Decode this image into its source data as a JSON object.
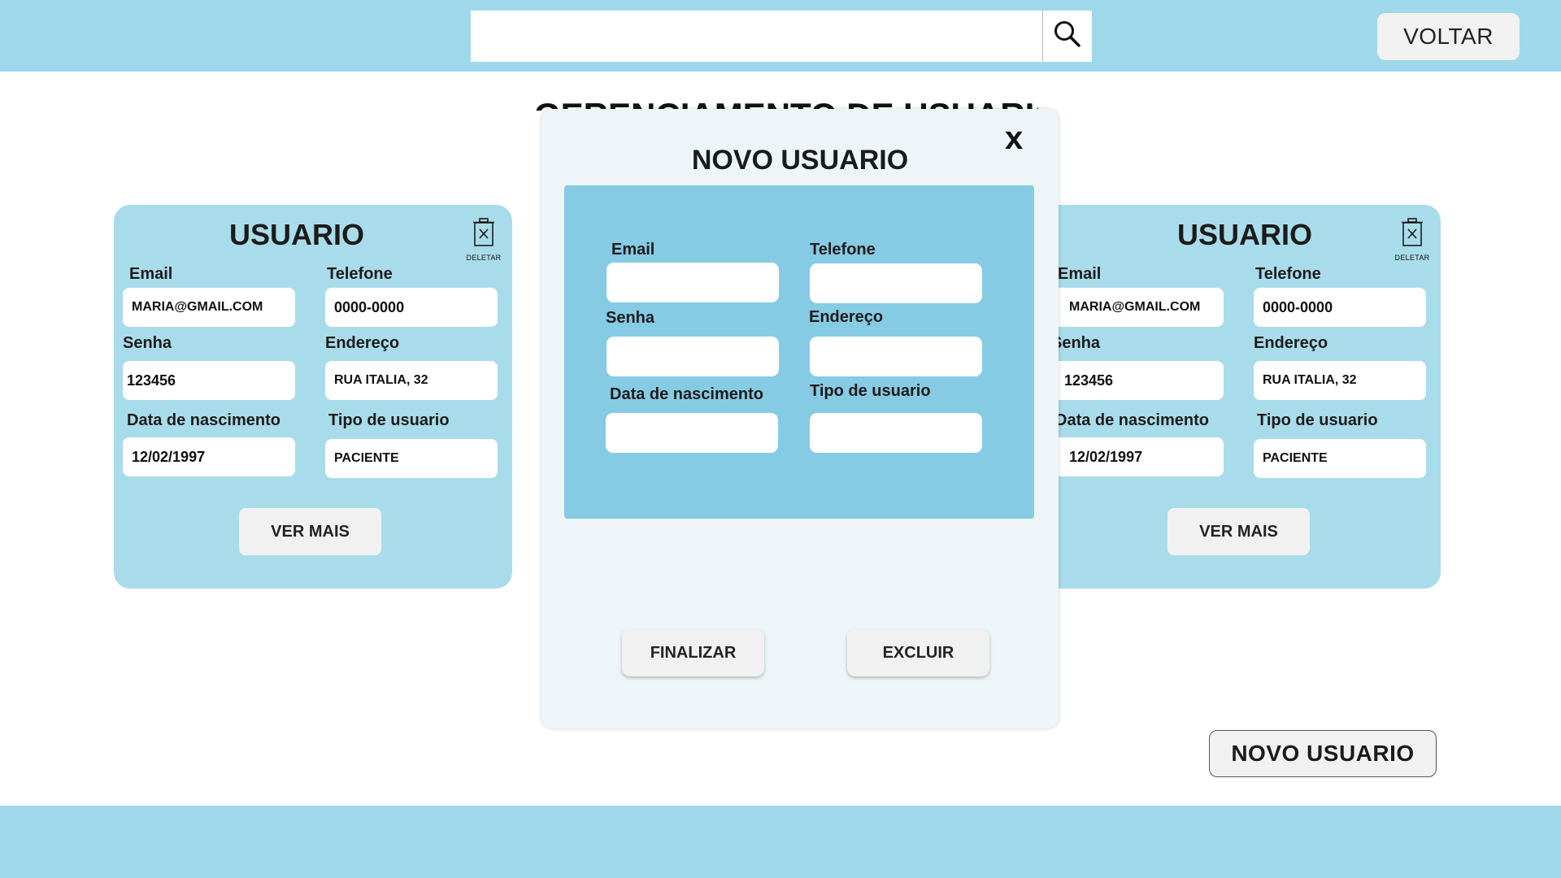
{
  "header": {
    "search": {
      "value": "",
      "icon": "search-icon"
    },
    "back_label": "VOLTAR"
  },
  "page": {
    "title": "GERENCIAMENTO DE USUARIO"
  },
  "cards": [
    {
      "title": "USUARIO",
      "delete_label": "DELETAR",
      "labels": {
        "email": "Email",
        "phone": "Telefone",
        "password": "Senha",
        "address": "Endereço",
        "birth": "Data de nascimento",
        "type": "Tipo de usuario"
      },
      "values": {
        "email": "MARIA@GMAIL.COM",
        "phone": "0000-0000",
        "password": "123456",
        "address": "RUA ITALIA, 32",
        "birth": "12/02/1997",
        "type": "PACIENTE"
      },
      "more_label": "VER MAIS"
    },
    {
      "title": "USUARIO",
      "delete_label": "DELETAR",
      "labels": {
        "email": "Email",
        "phone": "Telefone",
        "password": "Senha",
        "address": "Endereço",
        "birth": "Data de nascimento",
        "type": "Tipo de usuario"
      },
      "values": {
        "email": "MARIA@GMAIL.COM",
        "phone": "0000-0000",
        "password": "123456",
        "address": "RUA ITALIA, 32",
        "birth": "12/02/1997",
        "type": "PACIENTE"
      },
      "more_label": "VER MAIS"
    }
  ],
  "modal": {
    "title": "NOVO USUARIO",
    "close_label": "x",
    "labels": {
      "email": "Email",
      "phone": "Telefone",
      "password": "Senha",
      "address": "Endereço",
      "birth": "Data de nascimento",
      "type": "Tipo de usuario"
    },
    "values": {
      "email": "",
      "phone": "",
      "password": "",
      "address": "",
      "birth": "",
      "type": ""
    },
    "finish_label": "FINALIZAR",
    "delete_label": "EXCLUIR"
  },
  "new_user_label": "NOVO USUARIO",
  "colors": {
    "header_bg": "#9fd8ea",
    "card_bg": "#a9dcea",
    "modal_bg": "#edf5f8",
    "modal_panel_bg": "#86cbe4",
    "button_bg": "#f1f1f1"
  }
}
